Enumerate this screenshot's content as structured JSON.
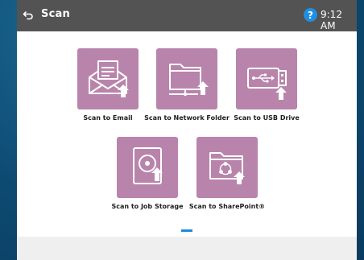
{
  "header": {
    "title": "Scan",
    "time": "9:12 AM",
    "help_glyph": "?",
    "back_icon": "back-arrow-icon"
  },
  "tiles": [
    {
      "label": "Scan to Email",
      "icon": "email-icon"
    },
    {
      "label": "Scan to Network Folder",
      "icon": "network-folder-icon"
    },
    {
      "label": "Scan to USB Drive",
      "icon": "usb-drive-icon"
    },
    {
      "label": "Scan to Job Storage",
      "icon": "job-storage-icon"
    },
    {
      "label": "Scan to SharePoint®",
      "icon": "sharepoint-icon"
    }
  ],
  "pagination": {
    "current_page": 1,
    "total_pages": 1
  },
  "colors": {
    "tile": "#b884ac",
    "topbar": "#535353",
    "help": "#1f8fe3",
    "page_indicator": "#1a8be0",
    "background": "#0d4a72"
  }
}
